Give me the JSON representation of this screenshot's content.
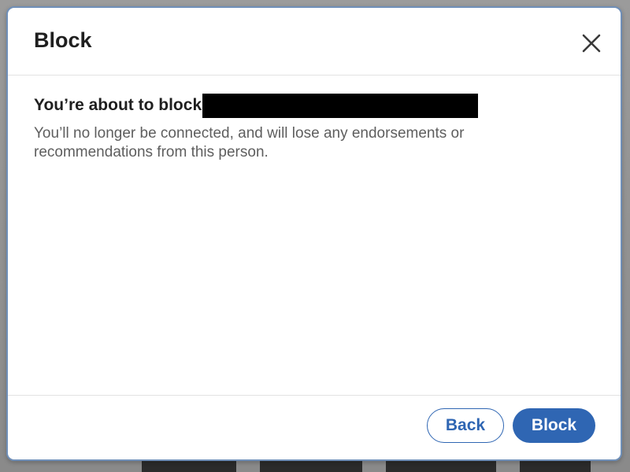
{
  "modal": {
    "title": "Block",
    "close_icon": "close-icon",
    "heading": "You’re about to block",
    "redacted_name": "",
    "description": "You’ll no longer be connected, and will lose any endorsements or recommendations from this person."
  },
  "footer": {
    "back_label": "Back",
    "block_label": "Block"
  },
  "colors": {
    "primary": "#2f66b3",
    "title_text": "#1f1f1f",
    "body_text": "#5e5e5e",
    "modal_border": "#6f8fb8"
  }
}
